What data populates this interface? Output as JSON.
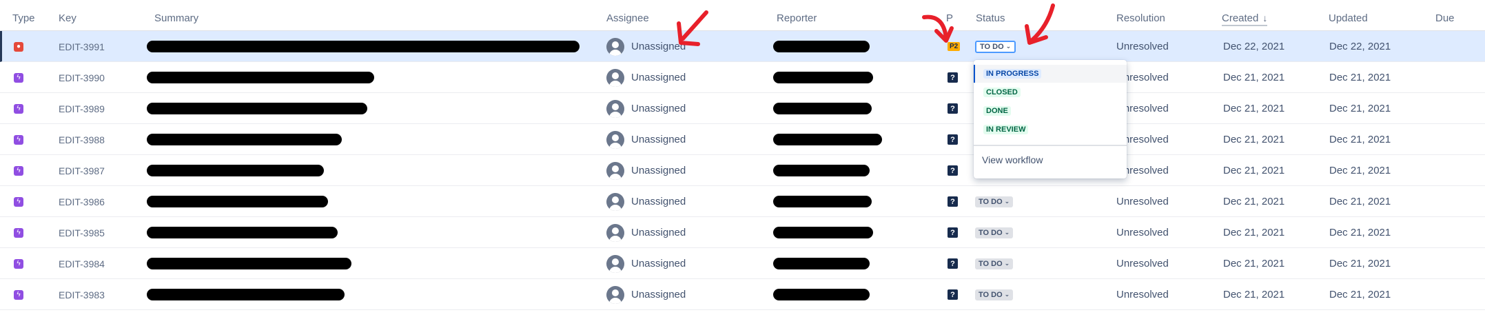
{
  "columns": {
    "type": "Type",
    "key": "Key",
    "summary": "Summary",
    "assignee": "Assignee",
    "reporter": "Reporter",
    "priority": "P",
    "status": "Status",
    "resolution": "Resolution",
    "created": "Created",
    "updated": "Updated",
    "due": "Due"
  },
  "sort_indicator": "↓",
  "rows": [
    {
      "type": "bug",
      "key": "EDIT-3991",
      "assignee": "Unassigned",
      "priority": "P2",
      "status": "TO DO",
      "resolution": "Unresolved",
      "created": "Dec 22, 2021",
      "updated": "Dec 22, 2021"
    },
    {
      "type": "story",
      "key": "EDIT-3990",
      "assignee": "Unassigned",
      "priority": "?",
      "status": "",
      "resolution": "Unresolved",
      "created": "Dec 21, 2021",
      "updated": "Dec 21, 2021"
    },
    {
      "type": "story",
      "key": "EDIT-3989",
      "assignee": "Unassigned",
      "priority": "?",
      "status": "",
      "resolution": "Unresolved",
      "created": "Dec 21, 2021",
      "updated": "Dec 21, 2021"
    },
    {
      "type": "story",
      "key": "EDIT-3988",
      "assignee": "Unassigned",
      "priority": "?",
      "status": "",
      "resolution": "Unresolved",
      "created": "Dec 21, 2021",
      "updated": "Dec 21, 2021"
    },
    {
      "type": "story",
      "key": "EDIT-3987",
      "assignee": "Unassigned",
      "priority": "?",
      "status": "",
      "resolution": "Unresolved",
      "created": "Dec 21, 2021",
      "updated": "Dec 21, 2021"
    },
    {
      "type": "story",
      "key": "EDIT-3986",
      "assignee": "Unassigned",
      "priority": "?",
      "status": "TO DO",
      "resolution": "Unresolved",
      "created": "Dec 21, 2021",
      "updated": "Dec 21, 2021"
    },
    {
      "type": "story",
      "key": "EDIT-3985",
      "assignee": "Unassigned",
      "priority": "?",
      "status": "TO DO",
      "resolution": "Unresolved",
      "created": "Dec 21, 2021",
      "updated": "Dec 21, 2021"
    },
    {
      "type": "story",
      "key": "EDIT-3984",
      "assignee": "Unassigned",
      "priority": "?",
      "status": "TO DO",
      "resolution": "Unresolved",
      "created": "Dec 21, 2021",
      "updated": "Dec 21, 2021"
    },
    {
      "type": "story",
      "key": "EDIT-3983",
      "assignee": "Unassigned",
      "priority": "?",
      "status": "TO DO",
      "resolution": "Unresolved",
      "created": "Dec 21, 2021",
      "updated": "Dec 21, 2021"
    }
  ],
  "status_menu": {
    "options": [
      "IN PROGRESS",
      "CLOSED",
      "DONE",
      "IN REVIEW"
    ],
    "link": "View workflow"
  },
  "icons": {
    "bug": "bug-icon",
    "story": "story-icon",
    "avatar": "default-avatar-icon",
    "chevron": "chevron-down-icon"
  },
  "colors": {
    "selected_row": "#deebff",
    "bug": "#e5493a",
    "story": "#904ee2",
    "priority_p2": "#ffab00",
    "annotation_arrow": "#e8202a",
    "focus_ring": "#4c9aff"
  }
}
